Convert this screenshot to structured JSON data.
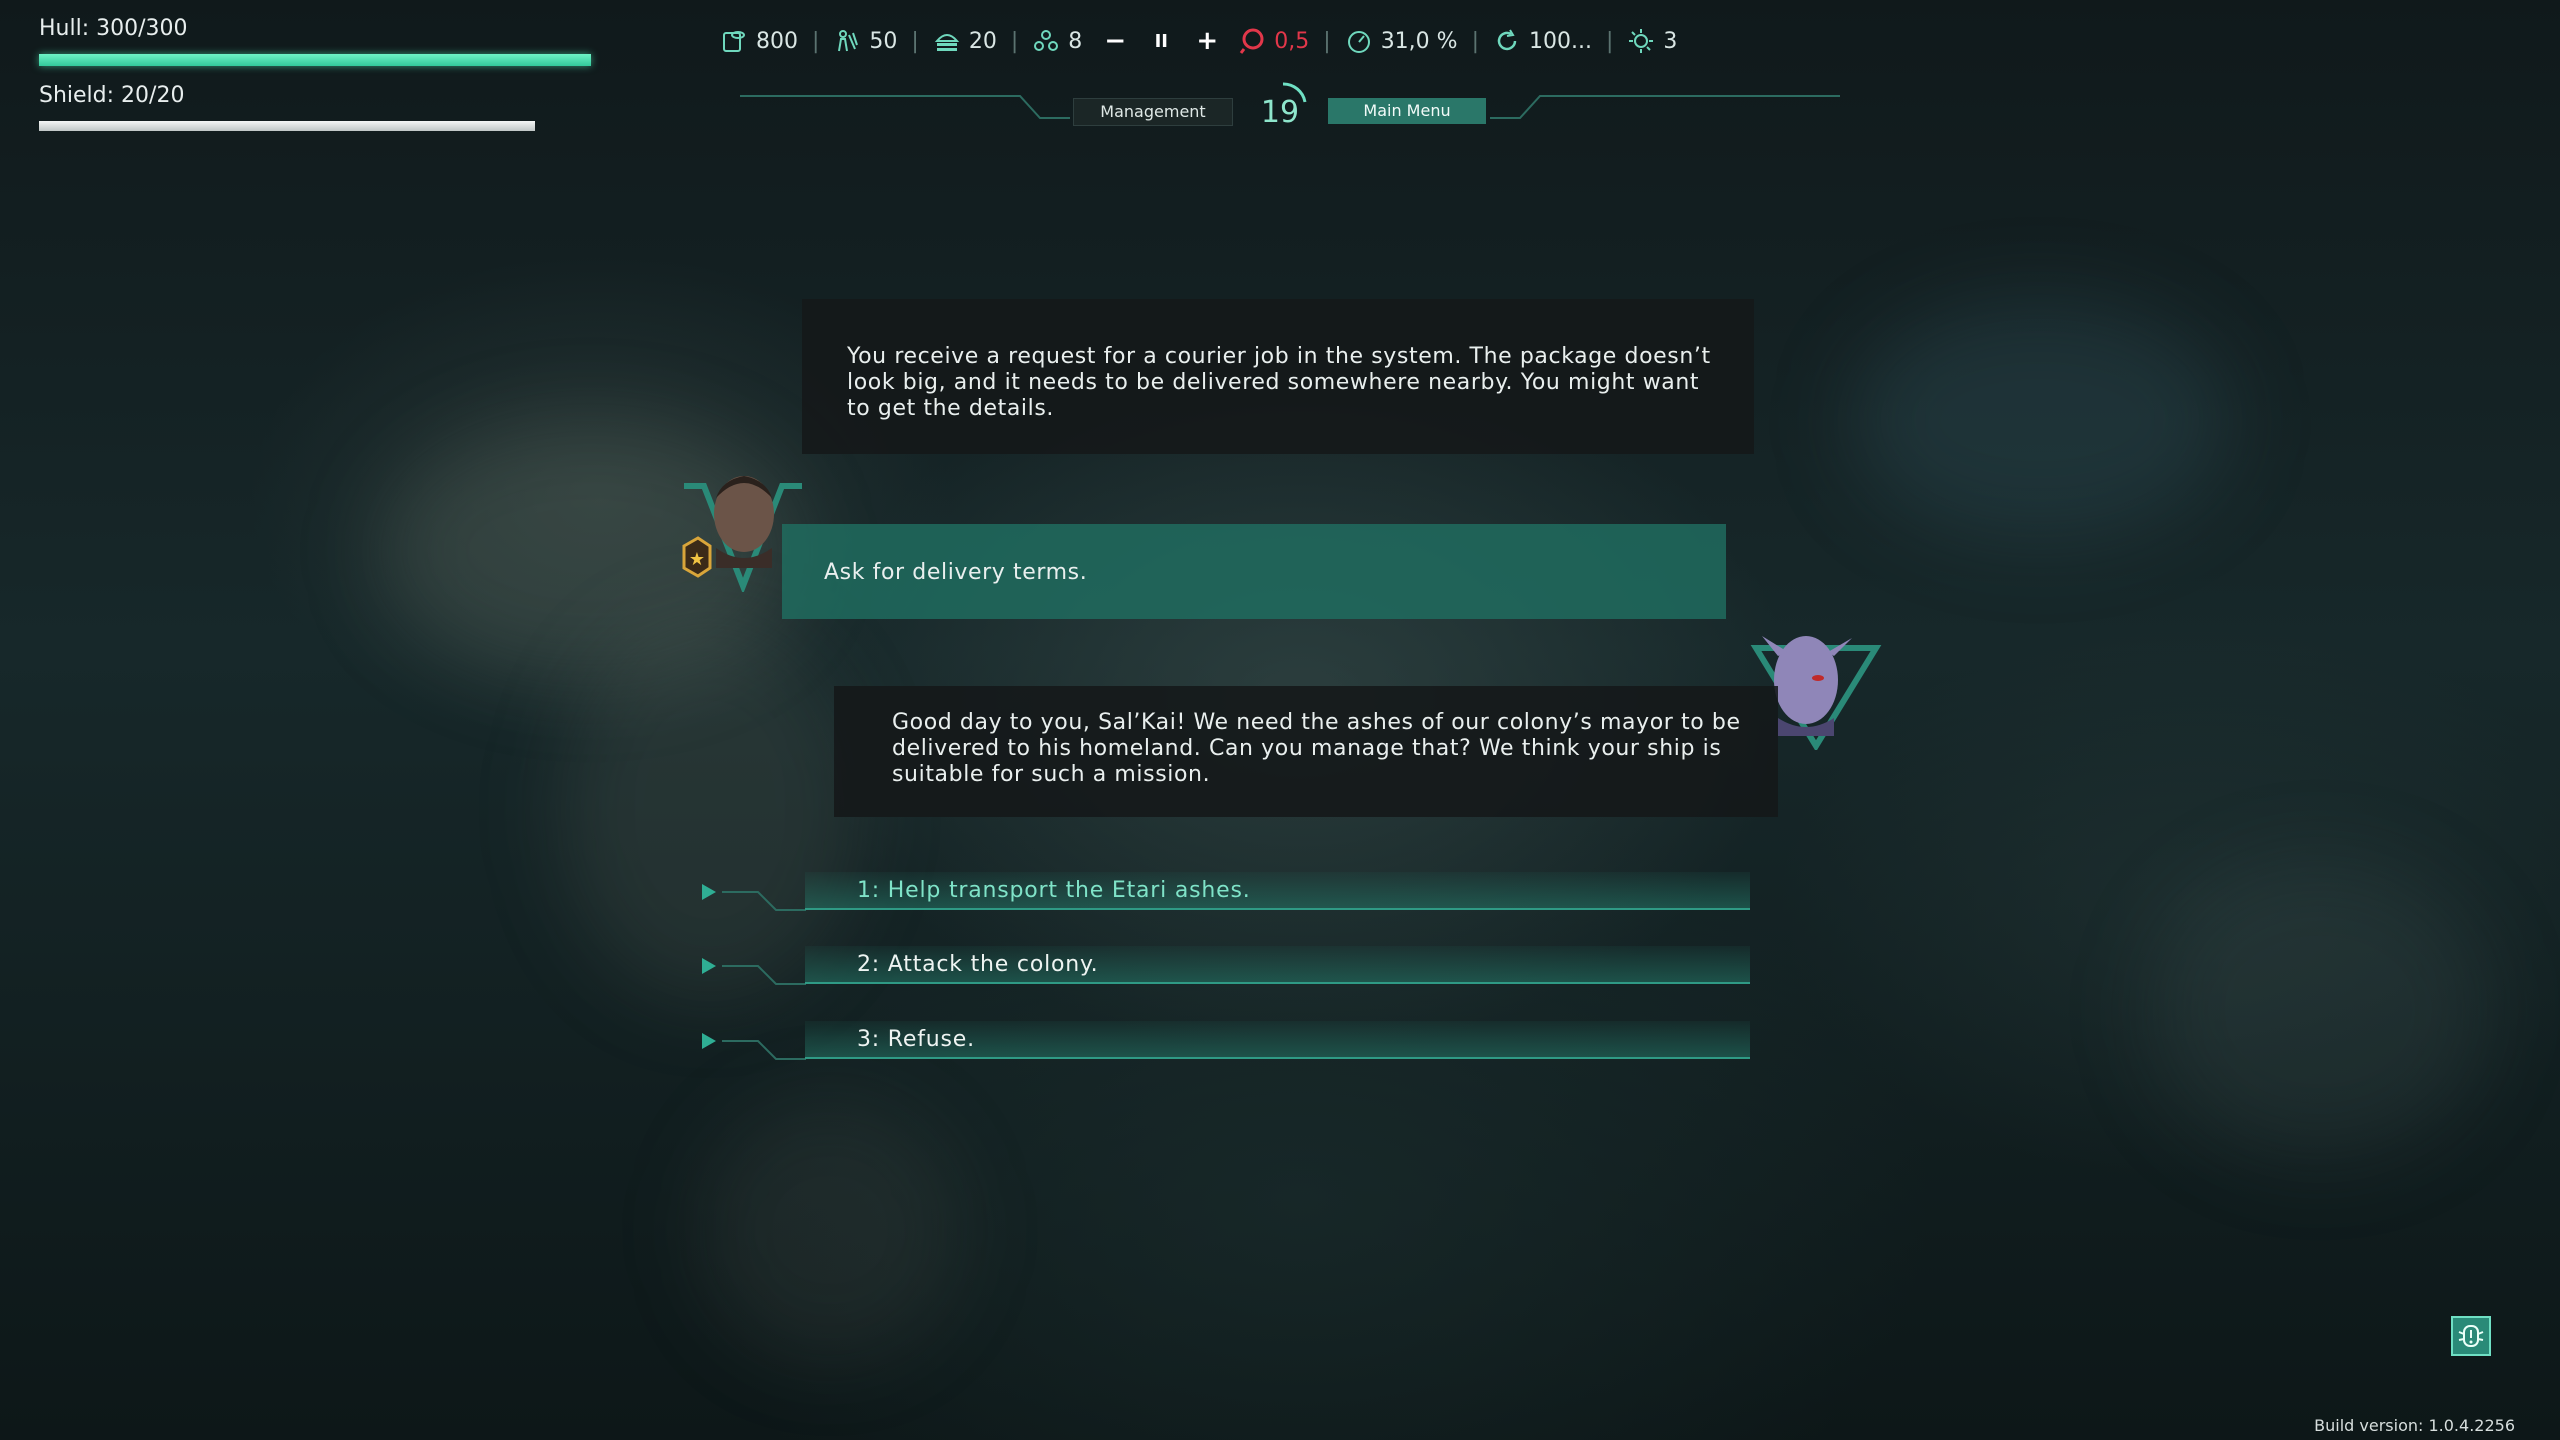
{
  "status": {
    "hull_label": "Hull: 300/300",
    "hull_fraction": 1.0,
    "shield_label": "Shield: 20/20",
    "shield_fraction": 1.0
  },
  "resources": {
    "credits": "800",
    "crew": "50",
    "cargo": "20",
    "hazard": "8",
    "threat": "0,5",
    "efficiency": "31,0 %",
    "cycle": "100...",
    "energy": "3"
  },
  "time_controls": {
    "slower": "−",
    "pause": "II",
    "faster": "+"
  },
  "nav": {
    "management": "Management",
    "turn": "19",
    "main_menu": "Main Menu"
  },
  "dialog": {
    "narration": "You receive a request for a courier job in the system. The package doesn’t look big, and it needs to be delivered somewhere nearby. You might want to get the details.",
    "player_reply": "Ask for delivery terms.",
    "npc_line": "Good day to you, Sal’Kai! We need the ashes of our colony’s mayor to be delivered to his homeland. Can you manage that? We think your ship is suitable for such a mission.",
    "options": [
      "1: Help transport the Etari ashes.",
      "2: Attack the colony.",
      "3: Refuse."
    ]
  },
  "footer": {
    "build_version": "Build version: 1.0.4.2256"
  },
  "colors": {
    "accent": "#2f9a85",
    "hull": "#4fe0b0",
    "danger": "#e2374a"
  },
  "icons": [
    "credits-icon",
    "crew-icon",
    "cargo-icon",
    "hazard-icon",
    "threat-icon",
    "efficiency-icon",
    "cycle-icon",
    "energy-icon",
    "bug-report-icon"
  ]
}
